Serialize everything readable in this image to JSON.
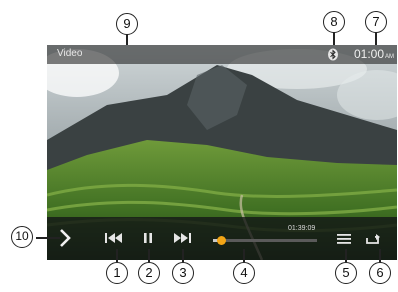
{
  "header": {
    "title": "Video",
    "clock_time": "01:00",
    "clock_ampm": "AM"
  },
  "playback": {
    "elapsed": "01:39:09",
    "progress_fraction": 0.08
  },
  "icons": {
    "next_screen": "chevron-right-icon",
    "prev": "skip-previous-icon",
    "pause": "pause-icon",
    "next": "skip-next-icon",
    "list": "playlist-icon",
    "repeat": "repeat-icon",
    "bluetooth": "bluetooth-icon"
  },
  "colors": {
    "accent": "#f2a516"
  },
  "callouts": [
    "1",
    "2",
    "3",
    "4",
    "5",
    "6",
    "7",
    "8",
    "9",
    "10"
  ]
}
